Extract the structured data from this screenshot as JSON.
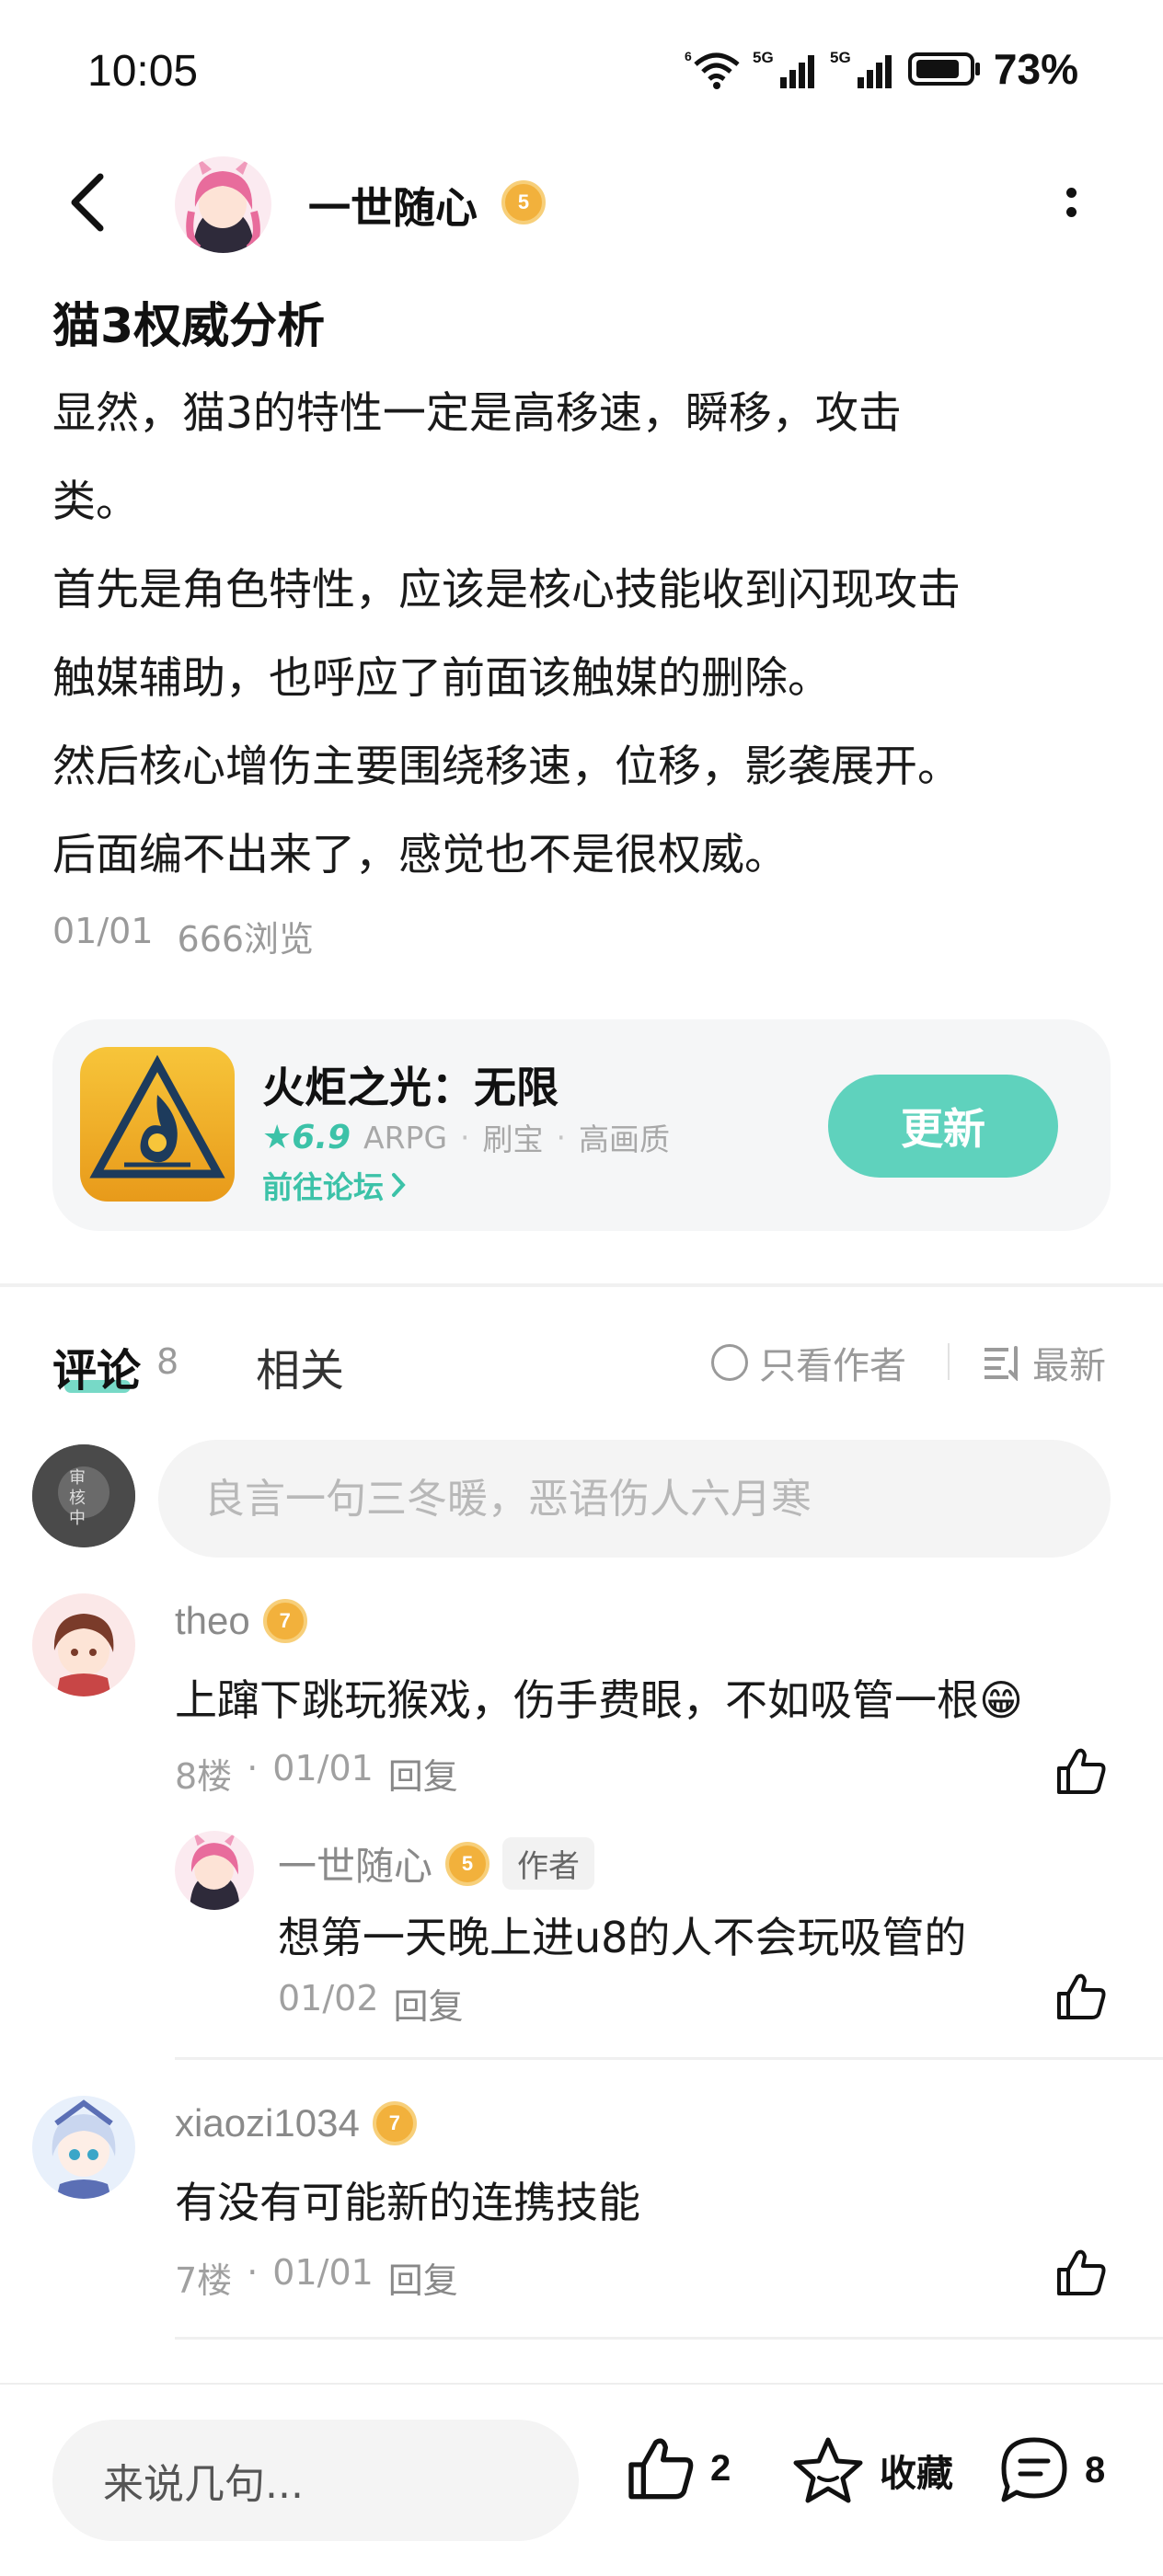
{
  "status_bar": {
    "time": "10:05",
    "battery": "73%",
    "network_1": "5G",
    "network_2": "5G",
    "wifi_label": "6"
  },
  "header": {
    "author_name": "一世随心",
    "author_level": "5"
  },
  "post": {
    "title": "猫3权威分析",
    "body_lines": [
      "显然，猫3的特性一定是高移速，瞬移，攻击",
      "类。",
      "首先是角色特性，应该是核心技能收到闪现攻击",
      "触媒辅助，也呼应了前面该触媒的删除。",
      "然后核心增伤主要围绕移速，位移，影袭展开。",
      "后面编不出来了，感觉也不是很权威。"
    ],
    "date": "01/01",
    "views": "666浏览"
  },
  "game_card": {
    "name": "火炬之光：无限",
    "score": "★6.9",
    "tags": [
      "ARPG",
      "刷宝",
      "高画质"
    ],
    "forum_link": "前往论坛",
    "action_button": "更新"
  },
  "tabs": {
    "comments_label": "评论",
    "comments_count": "8",
    "related_label": "相关",
    "only_author": "只看作者",
    "sort": "最新"
  },
  "comment_input": {
    "placeholder": "良言一句三冬暖，恶语伤人六月寒"
  },
  "comments": [
    {
      "user": "theo",
      "level": "7",
      "text": "上蹿下跳玩猴戏，伤手费眼，不如吸管一根😁",
      "floor": "8楼",
      "date": "01/01",
      "reply_label": "回复",
      "replies": [
        {
          "user": "一世随心",
          "level": "5",
          "tag": "作者",
          "text": "想第一天晚上进u8的人不会玩吸管的",
          "date": "01/02",
          "reply_label": "回复"
        }
      ]
    },
    {
      "user": "xiaozi1034",
      "level": "7",
      "text": "有没有可能新的连携技能",
      "floor": "7楼",
      "date": "01/01",
      "reply_label": "回复"
    }
  ],
  "bottom_bar": {
    "input_placeholder": "来说几句...",
    "likes": "2",
    "favorite_label": "收藏",
    "comments": "8"
  },
  "colors": {
    "accent": "#5fd2bd",
    "accent_text": "#3cc2a8",
    "badge": "#f2b13c"
  }
}
